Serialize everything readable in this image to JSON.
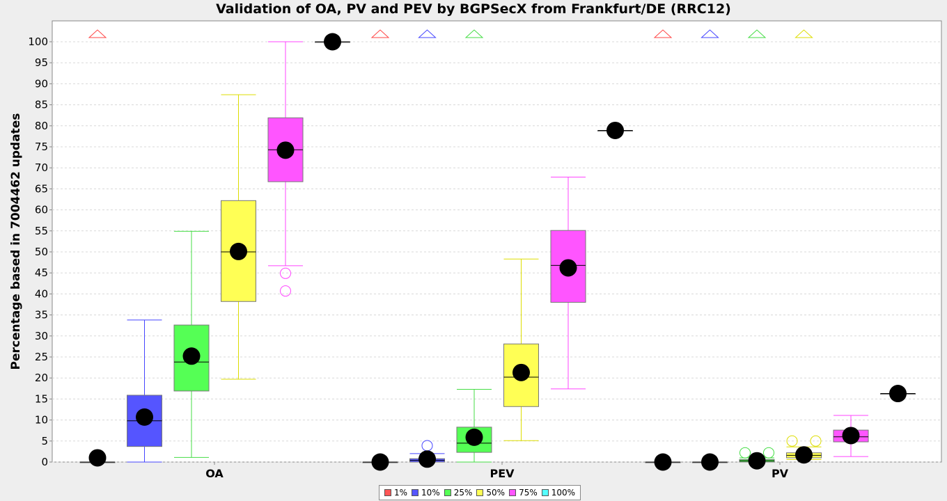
{
  "chart_data": {
    "type": "box",
    "title": "Validation of OA, PV and PEV by BGPSecX from Frankfurt/DE (RRC12)",
    "ylabel": "Percentage based in 7004462 updates",
    "xlabel": "",
    "ylim": [
      0,
      105
    ],
    "yticks": [
      0,
      5,
      10,
      15,
      20,
      25,
      30,
      35,
      40,
      45,
      50,
      55,
      60,
      65,
      70,
      75,
      80,
      85,
      90,
      95,
      100
    ],
    "grid": true,
    "legend_position": "bottom",
    "categories": [
      "OA",
      "PEV",
      "PV"
    ],
    "series": [
      {
        "name": "1%",
        "color": "#ff5555",
        "stroke": "#ff4444"
      },
      {
        "name": "10%",
        "color": "#5555ff",
        "stroke": "#4444ff"
      },
      {
        "name": "25%",
        "color": "#55ff55",
        "stroke": "#44dd44"
      },
      {
        "name": "50%",
        "color": "#ffff55",
        "stroke": "#dddd00"
      },
      {
        "name": "75%",
        "color": "#ff55ff",
        "stroke": "#ff44ff"
      },
      {
        "name": "100%",
        "color": "#55ffff",
        "stroke": "#44cccc"
      }
    ],
    "boxes": [
      {
        "category": "OA",
        "series": "1%",
        "min": 0,
        "q1": 0,
        "median": 0,
        "q3": 0,
        "max": 0,
        "mean": 1,
        "outliers": [
          1.2
        ],
        "far_outlier": true
      },
      {
        "category": "OA",
        "series": "10%",
        "min": 0,
        "q1": 3.7,
        "median": 9.8,
        "q3": 15.9,
        "max": 33.8,
        "mean": 10.7,
        "outliers": [],
        "far_outlier": false
      },
      {
        "category": "OA",
        "series": "25%",
        "min": 1.1,
        "q1": 16.9,
        "median": 23.8,
        "q3": 32.6,
        "max": 54.9,
        "mean": 25.2,
        "outliers": [],
        "far_outlier": false
      },
      {
        "category": "OA",
        "series": "50%",
        "min": 19.7,
        "q1": 38.2,
        "median": 50,
        "q3": 62.2,
        "max": 87.4,
        "mean": 50.1,
        "outliers": [],
        "far_outlier": false
      },
      {
        "category": "OA",
        "series": "75%",
        "min": 46.7,
        "q1": 66.7,
        "median": 74.3,
        "q3": 81.9,
        "max": 100,
        "mean": 74.2,
        "outliers": [
          44.9,
          40.7
        ],
        "far_outlier": false
      },
      {
        "category": "OA",
        "series": "100%",
        "min": 100,
        "q1": 100,
        "median": 100,
        "q3": 100,
        "max": 100,
        "mean": 100,
        "outliers": [],
        "far_outlier": false
      },
      {
        "category": "PEV",
        "series": "1%",
        "min": 0,
        "q1": 0,
        "median": 0,
        "q3": 0,
        "max": 0,
        "mean": 0,
        "outliers": [],
        "far_outlier": true
      },
      {
        "category": "PEV",
        "series": "10%",
        "min": 0,
        "q1": 0,
        "median": 0.4,
        "q3": 0.8,
        "max": 2.0,
        "mean": 0.7,
        "outliers": [
          3.9
        ],
        "far_outlier": true
      },
      {
        "category": "PEV",
        "series": "25%",
        "min": 0,
        "q1": 2.3,
        "median": 4.5,
        "q3": 8.3,
        "max": 17.3,
        "mean": 5.9,
        "outliers": [],
        "far_outlier": true
      },
      {
        "category": "PEV",
        "series": "50%",
        "min": 5.1,
        "q1": 13.2,
        "median": 20.2,
        "q3": 28.1,
        "max": 48.3,
        "mean": 21.3,
        "outliers": [],
        "far_outlier": false
      },
      {
        "category": "PEV",
        "series": "75%",
        "min": 17.4,
        "q1": 38,
        "median": 46.8,
        "q3": 55.1,
        "max": 67.8,
        "mean": 46.2,
        "outliers": [],
        "far_outlier": false
      },
      {
        "category": "PEV",
        "series": "100%",
        "min": 78.9,
        "q1": 78.9,
        "median": 78.9,
        "q3": 78.9,
        "max": 78.9,
        "mean": 78.9,
        "outliers": [],
        "far_outlier": false
      },
      {
        "category": "PV",
        "series": "1%",
        "min": 0,
        "q1": 0,
        "median": 0,
        "q3": 0,
        "max": 0,
        "mean": 0,
        "outliers": [],
        "far_outlier": true
      },
      {
        "category": "PV",
        "series": "10%",
        "min": 0,
        "q1": 0,
        "median": 0,
        "q3": 0,
        "max": 0,
        "mean": 0,
        "outliers": [],
        "far_outlier": true
      },
      {
        "category": "PV",
        "series": "25%",
        "min": 0,
        "q1": 0,
        "median": 0.3,
        "q3": 0.6,
        "max": 1.0,
        "mean": 0.3,
        "outliers": [
          2.2,
          2.2
        ],
        "far_outlier": true
      },
      {
        "category": "PV",
        "series": "50%",
        "min": 0.6,
        "q1": 1.0,
        "median": 1.6,
        "q3": 2.2,
        "max": 3.6,
        "mean": 1.7,
        "outliers": [
          5.0,
          5.0
        ],
        "far_outlier": true
      },
      {
        "category": "PV",
        "series": "75%",
        "min": 1.3,
        "q1": 4.8,
        "median": 6.0,
        "q3": 7.6,
        "max": 11.1,
        "mean": 6.3,
        "outliers": [],
        "far_outlier": false
      },
      {
        "category": "PV",
        "series": "100%",
        "min": 16.3,
        "q1": 16.3,
        "median": 16.3,
        "q3": 16.3,
        "max": 16.3,
        "mean": 16.3,
        "outliers": [],
        "far_outlier": false
      }
    ]
  }
}
